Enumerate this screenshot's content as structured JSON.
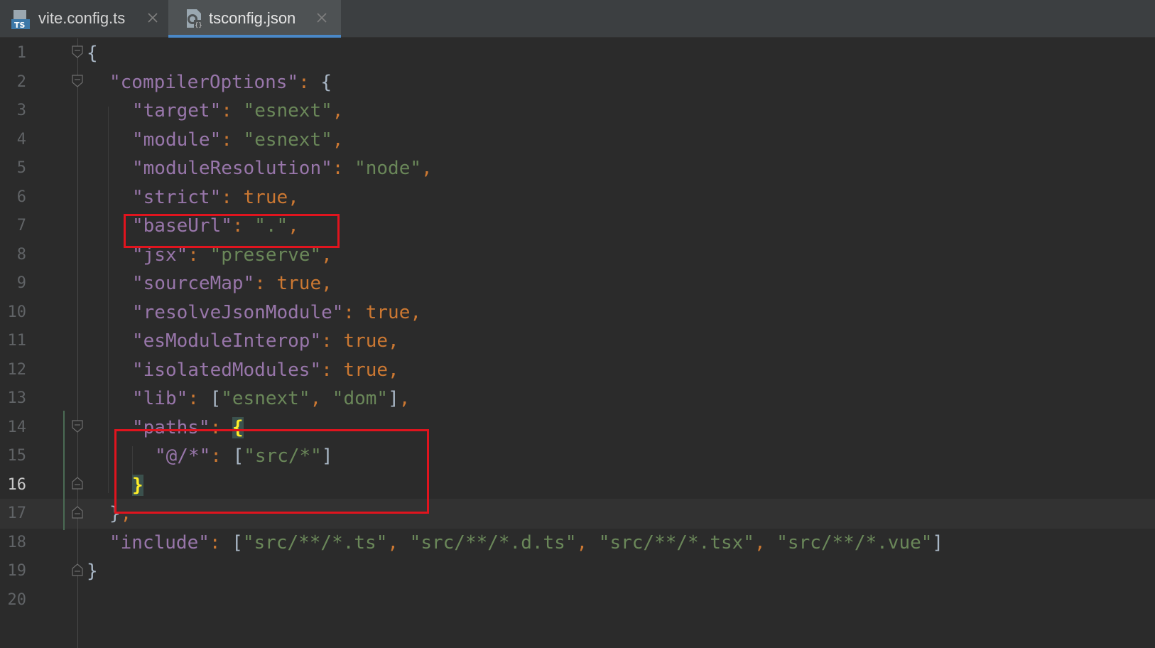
{
  "tabs": [
    {
      "label": "vite.config.ts",
      "icon": "typescript-file-icon",
      "active": false
    },
    {
      "label": "tsconfig.json",
      "icon": "json-config-file-icon",
      "active": true
    }
  ],
  "editor": {
    "current_line": 16,
    "lines": [
      {
        "n": "1"
      },
      {
        "n": "2"
      },
      {
        "n": "3"
      },
      {
        "n": "4"
      },
      {
        "n": "5"
      },
      {
        "n": "6"
      },
      {
        "n": "7"
      },
      {
        "n": "8"
      },
      {
        "n": "9"
      },
      {
        "n": "10"
      },
      {
        "n": "11"
      },
      {
        "n": "12"
      },
      {
        "n": "13"
      },
      {
        "n": "14"
      },
      {
        "n": "15"
      },
      {
        "n": "16"
      },
      {
        "n": "17"
      },
      {
        "n": "18"
      },
      {
        "n": "19"
      },
      {
        "n": "20"
      }
    ],
    "tokens": {
      "l1": {
        "brace": "{"
      },
      "l2": {
        "key": "\"compilerOptions\"",
        "colon": ":",
        "brace": " {"
      },
      "l3": {
        "key": "\"target\"",
        "colon": ":",
        "val": " \"esnext\"",
        "comma": ","
      },
      "l4": {
        "key": "\"module\"",
        "colon": ":",
        "val": " \"esnext\"",
        "comma": ","
      },
      "l5": {
        "key": "\"moduleResolution\"",
        "colon": ":",
        "val": " \"node\"",
        "comma": ","
      },
      "l6": {
        "key": "\"strict\"",
        "colon": ":",
        "val": " true",
        "comma": ","
      },
      "l7": {
        "key": "\"baseUrl\"",
        "colon": ":",
        "val": " \".\"",
        "comma": ","
      },
      "l8": {
        "key": "\"jsx\"",
        "colon": ":",
        "val": " \"preserve\"",
        "comma": ","
      },
      "l9": {
        "key": "\"sourceMap\"",
        "colon": ":",
        "val": " true",
        "comma": ","
      },
      "l10": {
        "key": "\"resolveJsonModule\"",
        "colon": ":",
        "val": " true",
        "comma": ","
      },
      "l11": {
        "key": "\"esModuleInterop\"",
        "colon": ":",
        "val": " true",
        "comma": ","
      },
      "l12": {
        "key": "\"isolatedModules\"",
        "colon": ":",
        "val": " true",
        "comma": ","
      },
      "l13": {
        "key": "\"lib\"",
        "colon": ":",
        "open": " [",
        "v1": "\"esnext\"",
        "sep": ", ",
        "v2": "\"dom\"",
        "close": "]",
        "comma": ","
      },
      "l14": {
        "key": "\"paths\"",
        "colon": ":",
        "space": " ",
        "brace": "{"
      },
      "l15": {
        "key": "\"@/*\"",
        "colon": ":",
        "open": " [",
        "v1": "\"src/*\"",
        "close": "]"
      },
      "l16": {
        "brace": "}"
      },
      "l17": {
        "brace": "}",
        "comma": ","
      },
      "l18": {
        "key": "\"include\"",
        "colon": ":",
        "open": " [",
        "v1": "\"src/**/*.ts\"",
        "sep1": ", ",
        "v2": "\"src/**/*.d.ts\"",
        "sep2": ", ",
        "v3": "\"src/**/*.tsx\"",
        "sep3": ", ",
        "v4": "\"src/**/*.vue\"",
        "close": "]"
      },
      "l19": {
        "brace": "}"
      }
    }
  },
  "colors": {
    "key": "#9876aa",
    "string": "#6a8759",
    "keyword": "#cc7832",
    "highlight_box": "#e0141e",
    "active_tab_underline": "#4a88c7"
  }
}
